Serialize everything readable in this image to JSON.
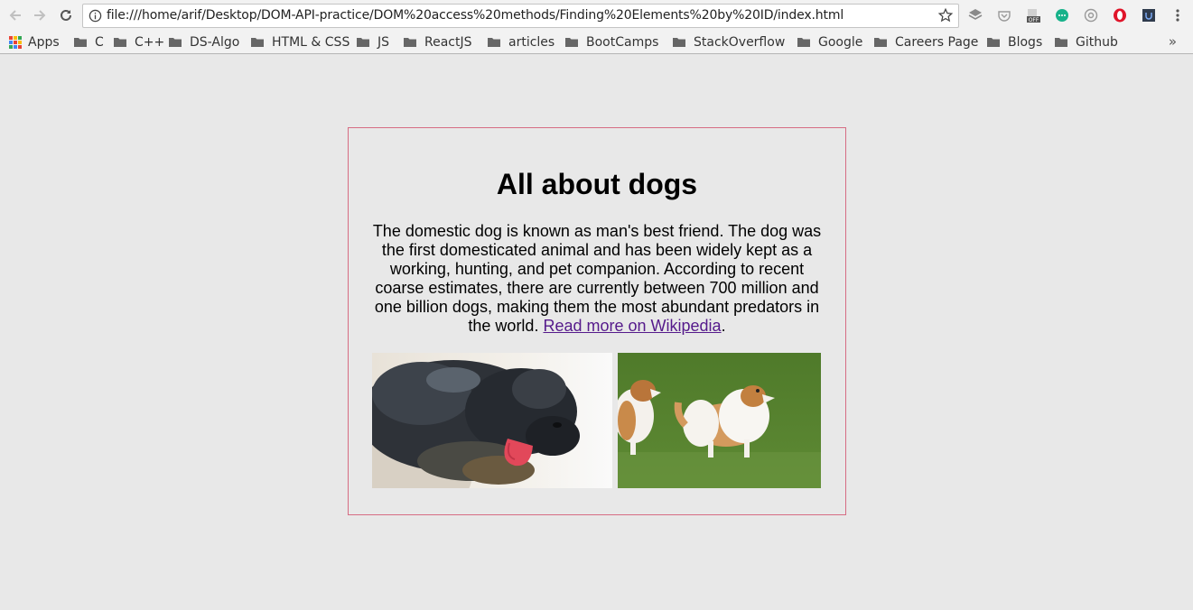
{
  "browser": {
    "url": "file:///home/arif/Desktop/DOM-API-practice/DOM%20access%20methods/Finding%20Elements%20by%20ID/index.html",
    "overflow_label": "»"
  },
  "bookmarks": [
    {
      "label": "Apps",
      "icon": "apps-grid-icon"
    },
    {
      "label": "C",
      "icon": "folder-icon"
    },
    {
      "label": "C++",
      "icon": "folder-icon"
    },
    {
      "label": "DS-Algo",
      "icon": "folder-icon"
    },
    {
      "label": "HTML & CSS",
      "icon": "folder-icon"
    },
    {
      "label": "JS",
      "icon": "folder-icon"
    },
    {
      "label": "ReactJS",
      "icon": "folder-icon"
    },
    {
      "label": "articles",
      "icon": "folder-icon"
    },
    {
      "label": "BootCamps",
      "icon": "folder-icon"
    },
    {
      "label": "StackOverflow",
      "icon": "folder-icon"
    },
    {
      "label": "Google",
      "icon": "folder-icon"
    },
    {
      "label": "Careers Page",
      "icon": "folder-icon"
    },
    {
      "label": "Blogs",
      "icon": "folder-icon"
    },
    {
      "label": "Github",
      "icon": "folder-icon"
    }
  ],
  "page": {
    "title": "All about dogs",
    "paragraph_text": "The domestic dog is known as man's best friend. The dog was the first domesticated animal and has been widely kept as a working, hunting, and pet companion. According to recent coarse estimates, there are currently between 700 million and one billion dogs, making them the most abundant predators in the world.",
    "link_text": "Read more on Wikipedia",
    "link_suffix": "."
  },
  "colors": {
    "page_background": "#e8e8e8",
    "card_border": "#d66c83",
    "link": "#551a8b"
  }
}
